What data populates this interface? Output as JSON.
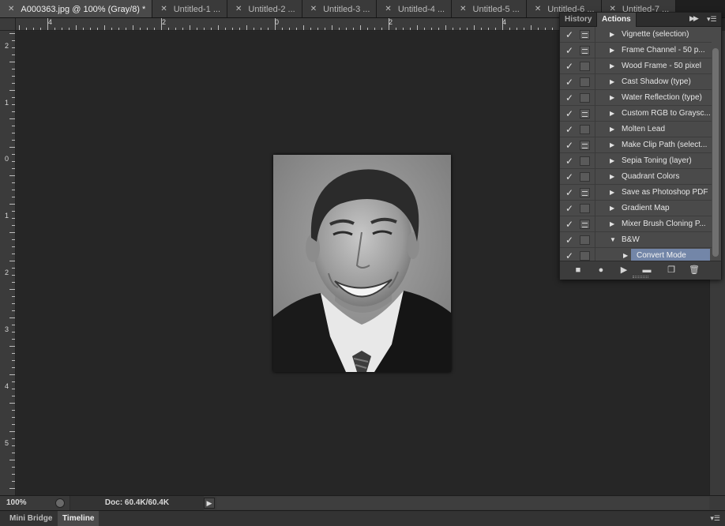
{
  "tabs": [
    {
      "label": "A000363.jpg @ 100% (Gray/8) *",
      "active": true
    },
    {
      "label": "Untitled-1 ...",
      "active": false
    },
    {
      "label": "Untitled-2 ...",
      "active": false
    },
    {
      "label": "Untitled-3 ...",
      "active": false
    },
    {
      "label": "Untitled-4 ...",
      "active": false
    },
    {
      "label": "Untitled-5 ...",
      "active": false
    },
    {
      "label": "Untitled-6 ...",
      "active": false
    },
    {
      "label": "Untitled-7 ...",
      "active": false
    }
  ],
  "ruler_top_labels": [
    "4",
    "2",
    "0",
    "2",
    "4"
  ],
  "ruler_left_labels": [
    "2",
    "1",
    "0",
    "1",
    "2",
    "3",
    "4",
    "5"
  ],
  "status": {
    "zoom": "100%",
    "doc": "Doc: 60.4K/60.4K"
  },
  "bottom_tabs": {
    "mini_bridge": "Mini Bridge",
    "timeline": "Timeline"
  },
  "panel": {
    "tab_history": "History",
    "tab_actions": "Actions",
    "actions": [
      {
        "label": "Vignette (selection)",
        "dialog": true
      },
      {
        "label": "Frame Channel - 50 p...",
        "dialog": true
      },
      {
        "label": "Wood Frame - 50 pixel",
        "dialog": false
      },
      {
        "label": "Cast Shadow (type)",
        "dialog": false
      },
      {
        "label": "Water Reflection (type)",
        "dialog": false
      },
      {
        "label": "Custom RGB to Graysc...",
        "dialog": true
      },
      {
        "label": "Molten Lead",
        "dialog": false
      },
      {
        "label": "Make Clip Path (select...",
        "dialog": true
      },
      {
        "label": "Sepia Toning (layer)",
        "dialog": false
      },
      {
        "label": "Quadrant Colors",
        "dialog": false
      },
      {
        "label": "Save as Photoshop PDF",
        "dialog": true
      },
      {
        "label": "Gradient Map",
        "dialog": false
      },
      {
        "label": "Mixer Brush Cloning P...",
        "dialog": true
      },
      {
        "label": "B&W",
        "dialog": false,
        "expanded": true
      },
      {
        "label": "Convert Mode",
        "dialog": false,
        "child": true,
        "selected": true
      }
    ]
  },
  "colors": {
    "selected_row": "#7386a8",
    "canvas_bg": "#262626"
  }
}
